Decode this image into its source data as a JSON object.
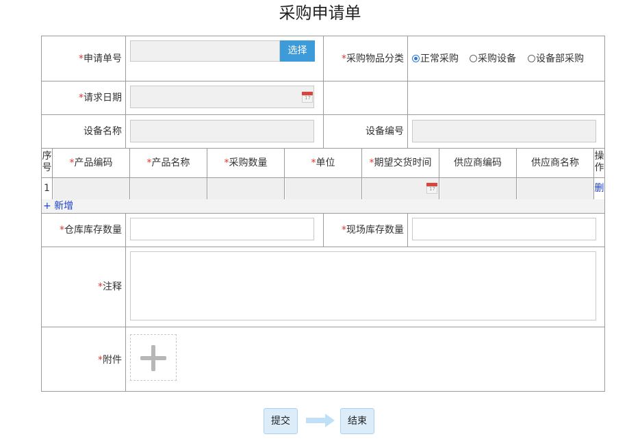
{
  "page_title": "采购申请单",
  "required_mark": "*",
  "form": {
    "request_no_label": "申请单号",
    "select_button": "选择",
    "category_label": "采购物品分类",
    "category_options": [
      "正常采购",
      "采购设备",
      "设备部采购"
    ],
    "category_selected": "正常采购",
    "request_date_label": "请求日期",
    "equipment_name_label": "设备名称",
    "equipment_no_label": "设备编号",
    "warehouse_stock_label": "仓库库存数量",
    "site_stock_label": "现场库存数量",
    "remark_label": "注释",
    "attachment_label": "附件"
  },
  "table": {
    "headers": [
      "序号",
      "产品编码",
      "产品名称",
      "采购数量",
      "单位",
      "期望交货时间",
      "供应商编码",
      "供应商名称",
      "操作"
    ],
    "rows": [
      {
        "index": "1",
        "delete": "删"
      }
    ],
    "add_link": "+ 新增"
  },
  "flow": {
    "submit": "提交",
    "end": "结束"
  },
  "colors": {
    "required": "#e0352b",
    "select_button": "#3e9bd9",
    "link": "#1a3fcf",
    "flow_button_bg": "#dcecf9"
  },
  "icons": {
    "date": "calendar-icon",
    "upload": "plus-icon",
    "flow_arrow": "arrow-right-icon"
  }
}
